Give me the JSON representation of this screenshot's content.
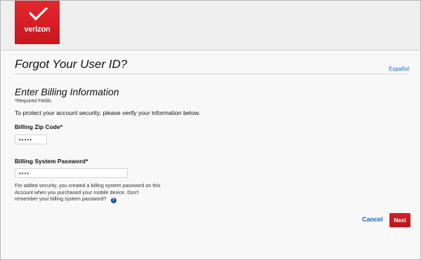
{
  "brand": {
    "logo_text": "verizon",
    "logo_color": "#d51f27"
  },
  "page": {
    "title": "Forgot Your User ID?",
    "language_link": "Español"
  },
  "form": {
    "section_title": "Enter Billing Information",
    "required_note": "*Required Fields",
    "instruction": "To protect your account security, please verify your information below.",
    "zip": {
      "label": "Billing Zip Code*",
      "value": "•••••"
    },
    "password": {
      "label": "Billing System Password*",
      "value": "••••",
      "help_text": "For added security, you created a billing system password on this Account when you purchased your mobile device. Don't remember your billing system password?",
      "help_icon": "question-icon"
    }
  },
  "actions": {
    "cancel_label": "Cancel",
    "next_label": "Next"
  }
}
